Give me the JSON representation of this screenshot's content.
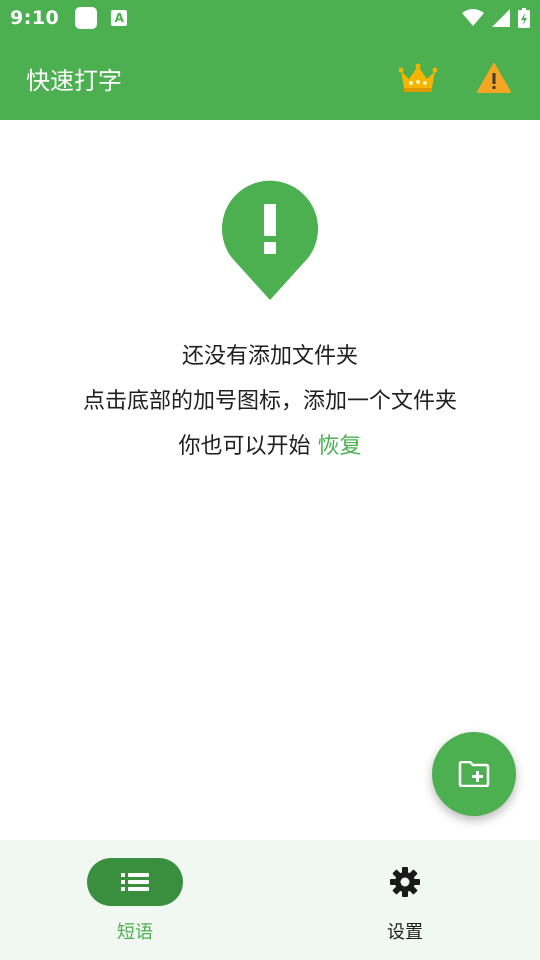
{
  "status_bar": {
    "time": "9:10",
    "notification_letter": "A"
  },
  "app_bar": {
    "title": "快速打字",
    "actions": [
      "crown-icon",
      "warning-icon"
    ]
  },
  "empty_state": {
    "line1": "还没有添加文件夹",
    "line2": "点击底部的加号图标，添加一个文件夹",
    "line3_prefix": "你也可以开始 ",
    "line3_link": "恢复"
  },
  "fab": {
    "icon": "folder-add-icon"
  },
  "bottom_nav": {
    "items": [
      {
        "label": "短语",
        "icon": "list-icon",
        "active": true
      },
      {
        "label": "设置",
        "icon": "gear-icon",
        "active": false
      }
    ]
  },
  "colors": {
    "primary": "#4caf50",
    "primary_dark": "#3a8f3e",
    "crown": "#f5b400",
    "warning": "#f5a623",
    "nav_background": "#f1f7f1"
  }
}
